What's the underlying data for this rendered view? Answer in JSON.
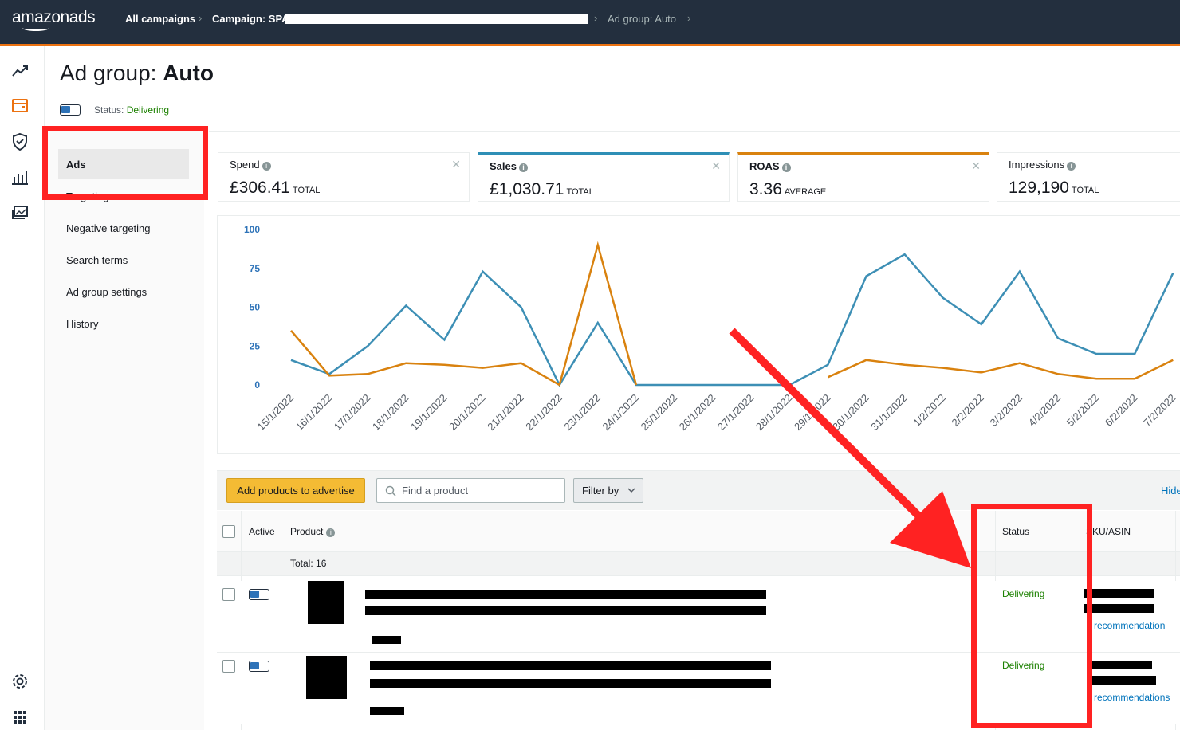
{
  "header": {
    "logo": "amazonads",
    "breadcrumbs": [
      "All campaigns",
      "Campaign: SPA",
      "Ad group: Auto"
    ]
  },
  "page": {
    "title_prefix": "Ad group:",
    "title_name": "Auto",
    "status_label": "Status:",
    "status_value": "Delivering"
  },
  "subnav": {
    "items": [
      "Ads",
      "Targeting",
      "Negative targeting",
      "Search terms",
      "Ad group settings",
      "History"
    ]
  },
  "kpis": [
    {
      "label": "Spend",
      "value": "£306.41",
      "unit": "TOTAL",
      "accent": ""
    },
    {
      "label": "Sales",
      "value": "£1,030.71",
      "unit": "TOTAL",
      "accent": "#2e8fb6"
    },
    {
      "label": "ROAS",
      "value": "3.36",
      "unit": "AVERAGE",
      "accent": "#d9820f"
    },
    {
      "label": "Impressions",
      "value": "129,190",
      "unit": "TOTAL",
      "accent": ""
    }
  ],
  "chart_data": {
    "type": "line",
    "x": [
      "15/1/2022",
      "16/1/2022",
      "17/1/2022",
      "18/1/2022",
      "19/1/2022",
      "20/1/2022",
      "21/1/2022",
      "22/1/2022",
      "23/1/2022",
      "24/1/2022",
      "25/1/2022",
      "26/1/2022",
      "27/1/2022",
      "28/1/2022",
      "29/1/2022",
      "30/1/2022",
      "31/1/2022",
      "1/2/2022",
      "2/2/2022",
      "3/2/2022",
      "4/2/2022",
      "5/2/2022",
      "6/2/2022",
      "7/2/2022"
    ],
    "yticks": [
      0,
      25,
      50,
      75,
      100
    ],
    "ylim": [
      0,
      100
    ],
    "series": [
      {
        "color": "#3d8fb5",
        "values": [
          16,
          7,
          25,
          51,
          29,
          73,
          50,
          0,
          40,
          0,
          0,
          0,
          0,
          0,
          13,
          70,
          84,
          56,
          39,
          73,
          30,
          20,
          20,
          72
        ]
      },
      {
        "color": "#d9820f",
        "values": [
          35,
          6,
          7,
          14,
          13,
          11,
          14,
          0,
          90,
          0,
          null,
          null,
          null,
          null,
          5,
          16,
          13,
          11,
          8,
          14,
          7,
          4,
          4,
          16
        ]
      }
    ]
  },
  "toolbar": {
    "add_label": "Add products to advertise",
    "search_placeholder": "Find a product",
    "filter_label": "Filter by",
    "hide_label": "Hide"
  },
  "table": {
    "columns": {
      "active": "Active",
      "product": "Product",
      "status": "Status",
      "sku": "SKU/ASIN"
    },
    "total_label": "Total: 16",
    "rows": [
      {
        "status": "Delivering",
        "link": "recommendation"
      },
      {
        "status": "Delivering",
        "link": "recommendations"
      }
    ]
  }
}
